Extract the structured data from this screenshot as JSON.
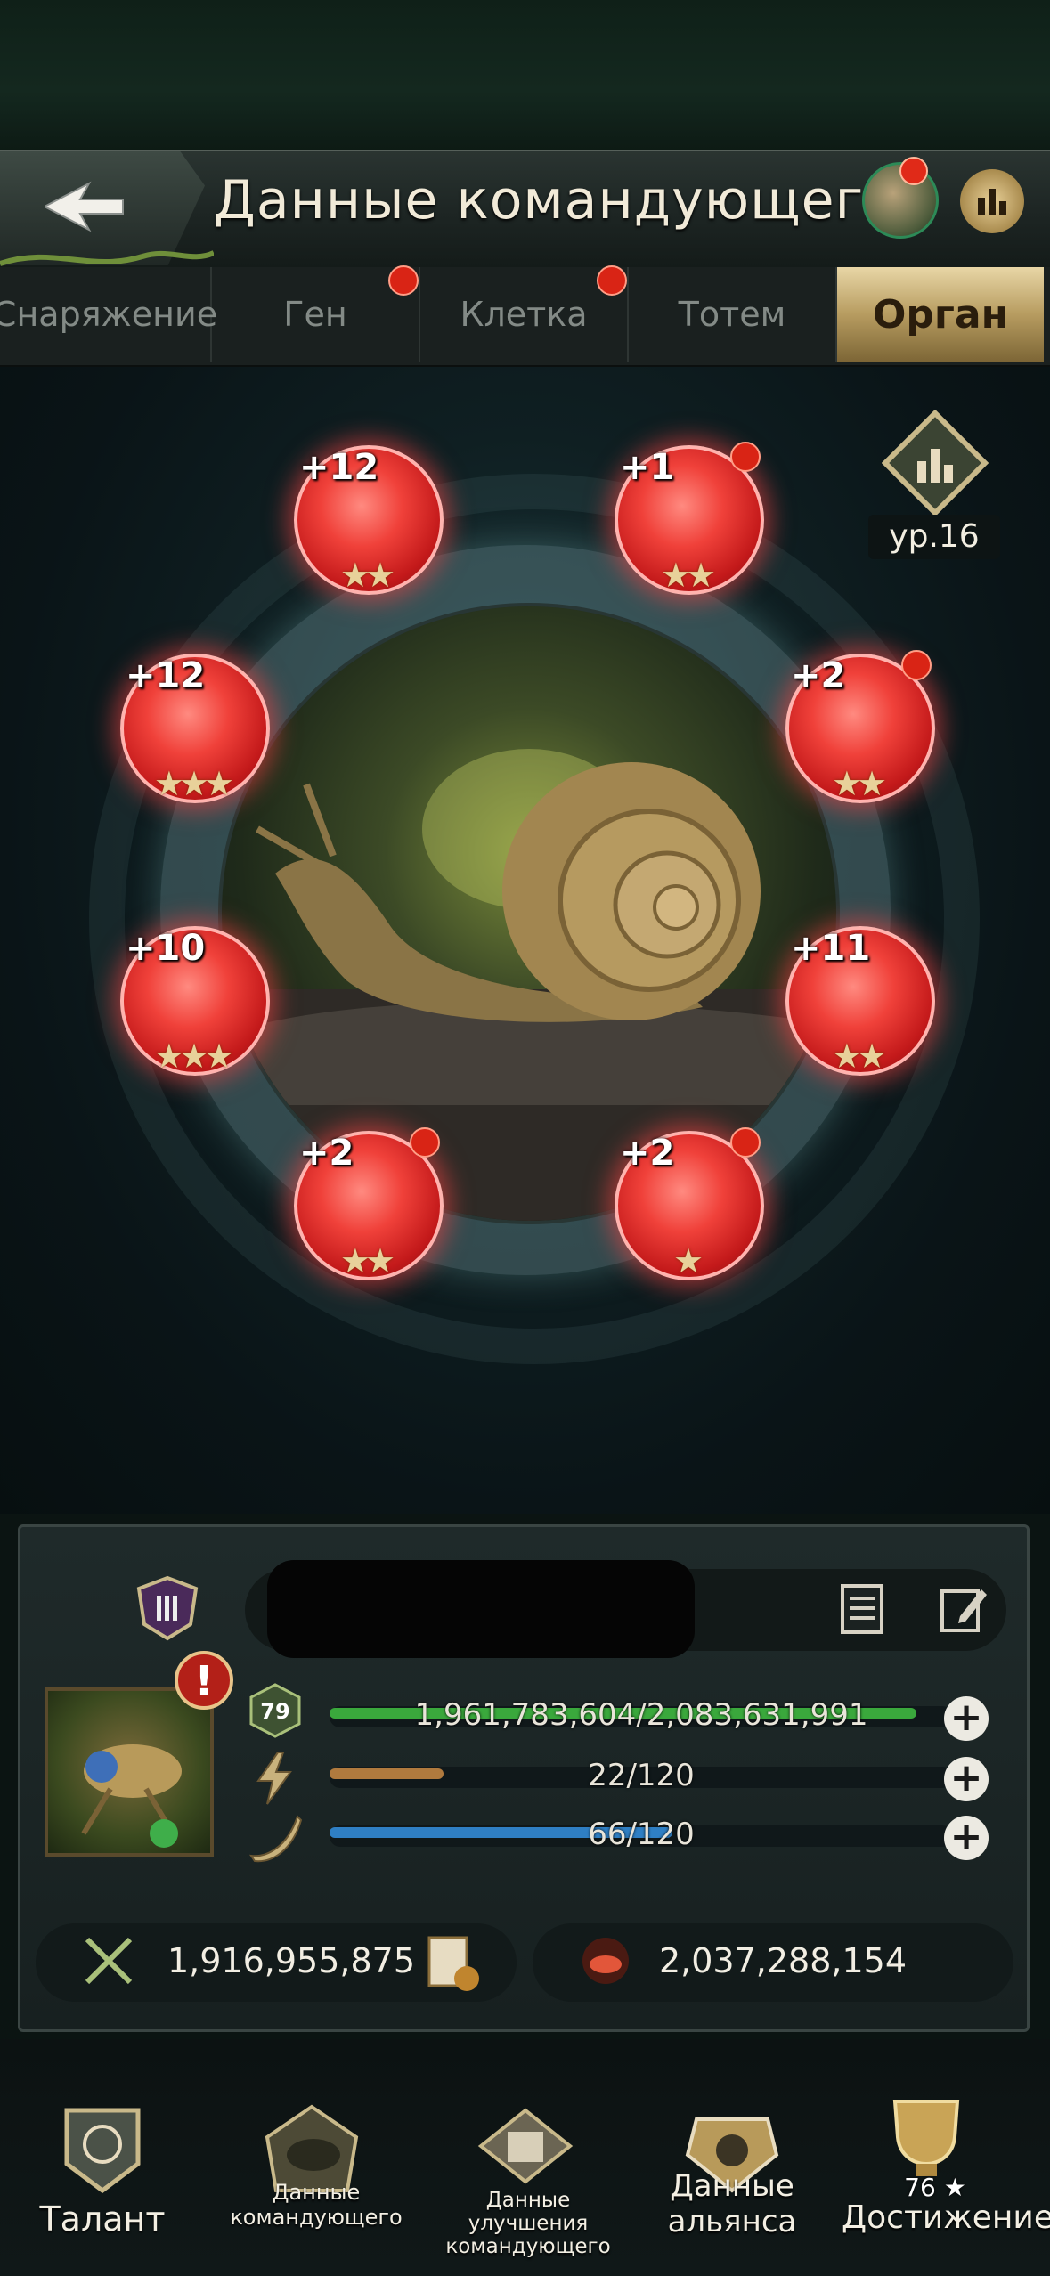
{
  "header": {
    "title": "Данные командующего",
    "back_icon": "back-arrow-icon",
    "mascot_icon": "mascot-icon",
    "rank_icon": "ranking-icon"
  },
  "tabs": [
    {
      "label": "Снаряжение",
      "active": false,
      "dot": false
    },
    {
      "label": "Ген",
      "active": false,
      "dot": true
    },
    {
      "label": "Клетка",
      "active": false,
      "dot": true
    },
    {
      "label": "Тотем",
      "active": false,
      "dot": false
    },
    {
      "label": "Орган",
      "active": true,
      "dot": false
    }
  ],
  "organ_level": "ур.16",
  "organs": [
    {
      "plus": "+12",
      "stars": "★★",
      "dot": false
    },
    {
      "plus": "+1",
      "stars": "★★",
      "dot": true
    },
    {
      "plus": "+12",
      "stars": "★★★",
      "dot": false
    },
    {
      "plus": "+2",
      "stars": "★★",
      "dot": true
    },
    {
      "plus": "+10",
      "stars": "★★★",
      "dot": false
    },
    {
      "plus": "+11",
      "stars": "★★",
      "dot": false
    },
    {
      "plus": "+2",
      "stars": "★★",
      "dot": true
    },
    {
      "plus": "+2",
      "stars": "★",
      "dot": true
    }
  ],
  "commander": {
    "level": "79",
    "hp": {
      "text": "1,961,783,604/2,083,631,991",
      "fraction": 0.942,
      "color": "#3aa83c"
    },
    "energy": {
      "text": "22/120",
      "fraction": 0.183,
      "color": "#b07a3e"
    },
    "stamina": {
      "text": "66/120",
      "fraction": 0.55,
      "color": "#2f7fc4"
    },
    "alert": "!",
    "power": "1,916,955,875",
    "kills": "2,037,288,154"
  },
  "nav": [
    {
      "label": "Талант",
      "icon": "talent-icon"
    },
    {
      "label": "Данные командующего",
      "icon": "commander-data-icon"
    },
    {
      "label": "Данные улучшения командующего",
      "icon": "upgrade-data-icon"
    },
    {
      "label": "Данные альянса",
      "icon": "alliance-data-icon"
    },
    {
      "label": "Достижение",
      "icon": "achievement-icon",
      "badge": "76 ★"
    }
  ]
}
